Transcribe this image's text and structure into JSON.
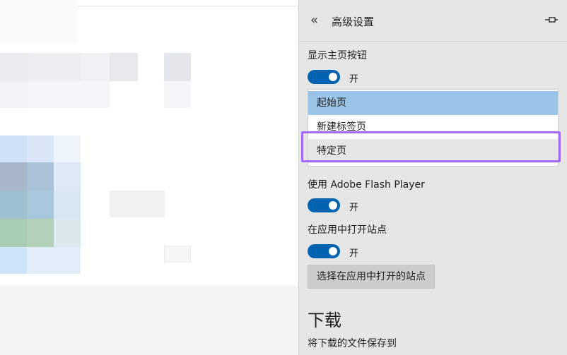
{
  "panel": {
    "title": "高级设置",
    "back_icon": "«",
    "home_button": {
      "label": "显示主页按钮",
      "state": "开"
    },
    "homepage_options": [
      {
        "label": "起始页",
        "selected": true
      },
      {
        "label": "新建标签页",
        "selected": false
      },
      {
        "label": "特定页",
        "selected": false
      }
    ],
    "flash": {
      "label": "使用 Adobe Flash Player",
      "state": "开"
    },
    "open_in_app": {
      "label": "在应用中打开站点",
      "state": "开",
      "button": "选择在应用中打开的站点"
    },
    "downloads": {
      "heading": "下载",
      "save_to": "将下载的文件保存到"
    }
  },
  "colors": {
    "toggle_on": "#0063b1",
    "selected_option": "#99c4e8",
    "highlight": "#a36bf5",
    "panel_bg": "#e6e6e6"
  }
}
